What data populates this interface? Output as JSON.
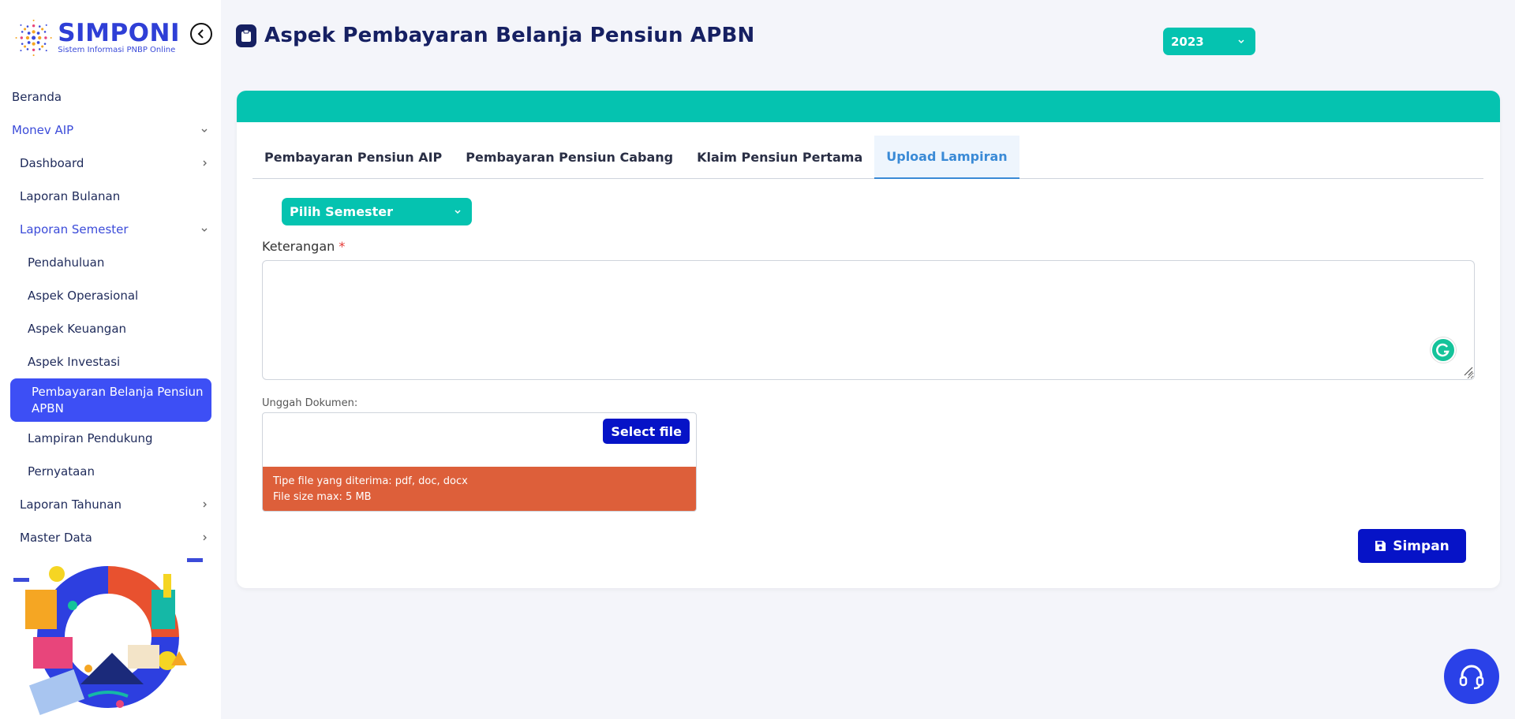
{
  "app": {
    "logo_title": "SIMPONI",
    "logo_subtitle": "Sistem Informasi PNBP Online"
  },
  "sidebar": {
    "items": [
      {
        "label": "Beranda"
      },
      {
        "label": "Monev AIP"
      },
      {
        "label": "Dashboard"
      },
      {
        "label": "Laporan Bulanan"
      },
      {
        "label": "Laporan Semester"
      },
      {
        "label": "Pendahuluan"
      },
      {
        "label": "Aspek Operasional"
      },
      {
        "label": "Aspek Keuangan"
      },
      {
        "label": "Aspek Investasi"
      },
      {
        "label": "Pembayaran Belanja Pensiun APBN"
      },
      {
        "label": "Lampiran Pendukung"
      },
      {
        "label": "Pernyataan"
      },
      {
        "label": "Laporan Tahunan"
      },
      {
        "label": "Master Data"
      }
    ]
  },
  "header": {
    "title": "Aspek Pembayaran Belanja Pensiun APBN",
    "year": "2023"
  },
  "tabs": [
    {
      "label": "Pembayaran Pensiun AIP"
    },
    {
      "label": "Pembayaran Pensiun Cabang"
    },
    {
      "label": "Klaim Pensiun Pertama"
    },
    {
      "label": "Upload Lampiran"
    }
  ],
  "form": {
    "semester_select": "Pilih Semester",
    "keterangan_label": "Keterangan",
    "required_mark": "*",
    "keterangan_value": "",
    "upload_label": "Unggah Dokumen:",
    "select_file_label": "Select file",
    "file_types": "Tipe file yang diterima: pdf, doc, docx",
    "file_size": "File size max: 5 MB",
    "save_label": "Simpan"
  },
  "colors": {
    "primary": "#3d4ff5",
    "teal": "#05c3b0",
    "navy": "#162062",
    "dark_blue": "#0613c7",
    "warning": "#dd5f3a"
  }
}
